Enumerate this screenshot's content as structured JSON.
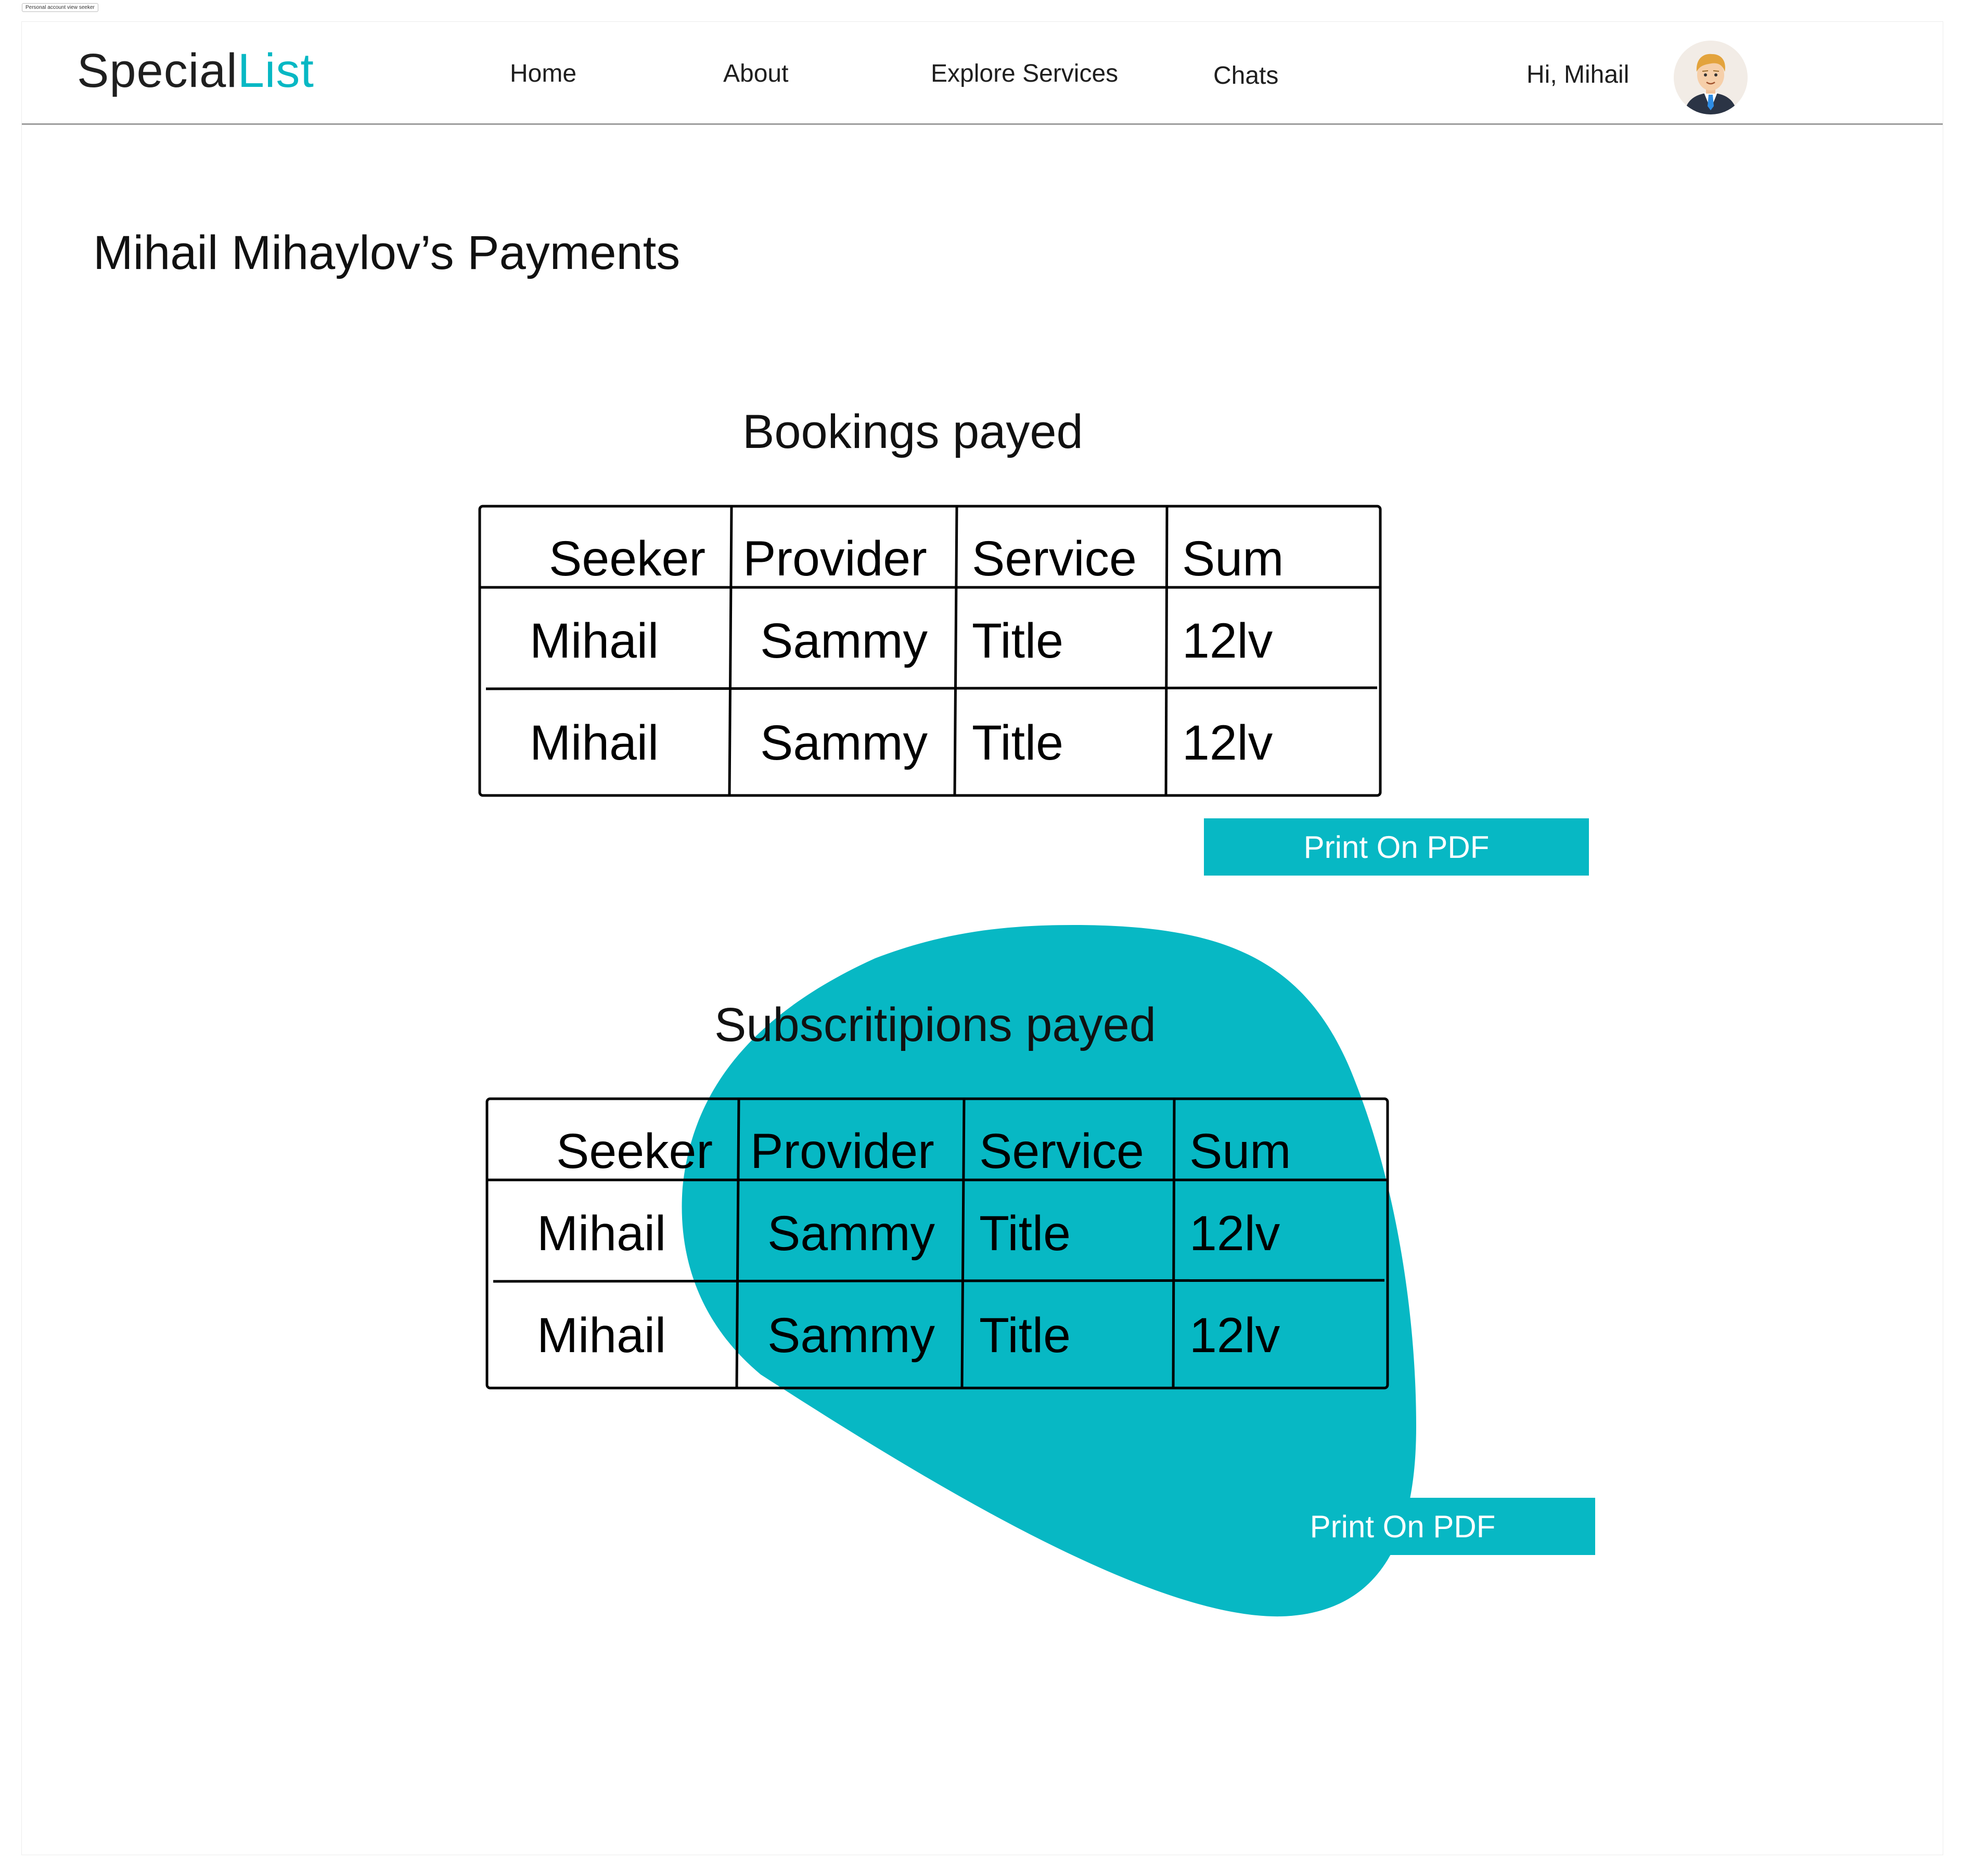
{
  "frame_label": "Personal account view seeker",
  "header": {
    "logo_part1": "Special",
    "logo_part2": "List",
    "nav": {
      "home": "Home",
      "about": "About",
      "explore": "Explore Services",
      "chats": "Chats"
    },
    "greeting": "Hi, Mihail"
  },
  "page_title": "Mihail Mihaylov’s Payments",
  "bookings": {
    "title": "Bookings payed",
    "headers": [
      "Seeker",
      "Provider",
      "Service",
      "Sum"
    ],
    "rows": [
      [
        "Mihail",
        "Sammy",
        "Title",
        "12lv"
      ],
      [
        "Mihail",
        "Sammy",
        "Title",
        "12lv"
      ]
    ],
    "print_label": "Print On PDF"
  },
  "subscriptions": {
    "title": "Subscritipions payed",
    "headers": [
      "Seeker",
      "Provider",
      "Service",
      "Sum"
    ],
    "rows": [
      [
        "Mihail",
        "Sammy",
        "Title",
        "12lv"
      ],
      [
        "Mihail",
        "Sammy",
        "Title",
        "12lv"
      ]
    ],
    "print_label": "Print On PDF"
  },
  "colors": {
    "accent": "#07b8c4",
    "text": "#1f1f1f",
    "divider": "#9c9c9c"
  },
  "icons": {
    "avatar": "user-avatar-icon"
  }
}
